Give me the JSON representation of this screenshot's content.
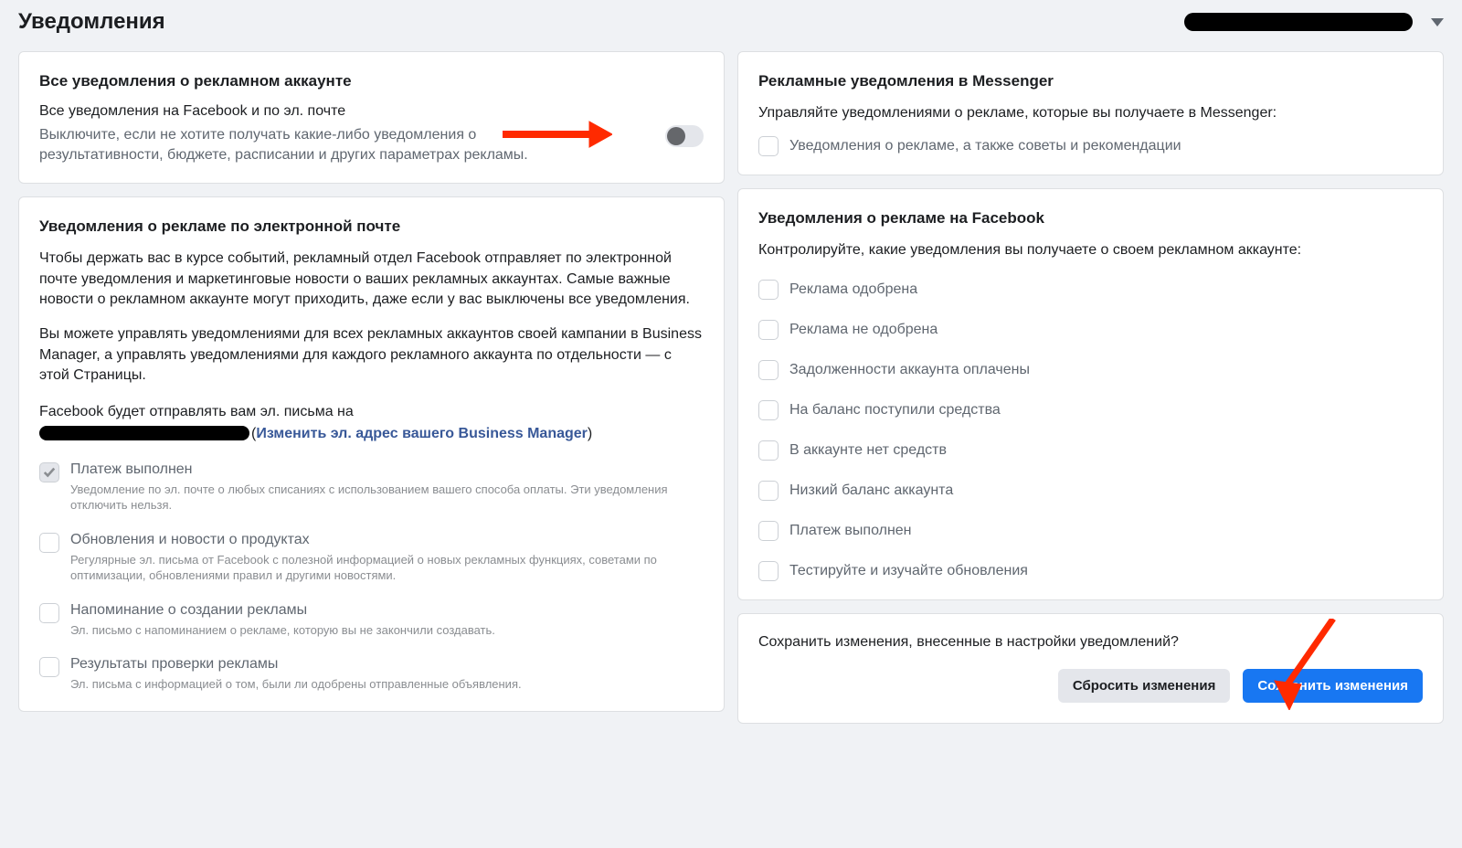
{
  "page": {
    "title": "Уведомления"
  },
  "left": {
    "allAdNotif": {
      "title": "Все уведомления о рекламном аккаунте",
      "subtitle": "Все уведомления на Facebook и по эл. почте",
      "desc": "Выключите, если не хотите получать какие-либо уведомления о результативности, бюджете, расписании и других параметрах рекламы."
    },
    "emailNotif": {
      "title": "Уведомления о рекламе по электронной почте",
      "p1": "Чтобы держать вас в курсе событий, рекламный отдел Facebook отправляет по электронной почте уведомления и маркетинговые новости о ваших рекламных аккаунтах. Самые важные новости о рекламном аккаунте могут приходить, даже если у вас выключены все уведомления.",
      "p2": "Вы можете управлять уведомлениями для всех рекламных аккаунтов своей кампании в Business Manager, а управлять уведомлениями для каждого рекламного аккаунта по отдельности — с этой Страницы.",
      "emailLine1": "Facebook будет отправлять вам эл. письма на",
      "emailChangeOpen": "(",
      "emailChangeLink": "Изменить эл. адрес вашего Business Manager",
      "emailChangeClose": ")",
      "items": [
        {
          "label": "Платеж выполнен",
          "sub": "Уведомление по эл. почте о любых списаниях с использованием вашего способа оплаты. Эти уведомления отключить нельзя.",
          "checkedDisabled": true
        },
        {
          "label": "Обновления и новости о продуктах",
          "sub": "Регулярные эл. письма от Facebook с полезной информацией о новых рекламных функциях, советами по оптимизации, обновлениями правил и другими новостями."
        },
        {
          "label": "Напоминание о создании рекламы",
          "sub": "Эл. письмо с напоминанием о рекламе, которую вы не закончили создавать."
        },
        {
          "label": "Результаты проверки рекламы",
          "sub": "Эл. письма с информацией о том, были ли одобрены отправленные объявления."
        }
      ]
    }
  },
  "right": {
    "messenger": {
      "title": "Рекламные уведомления в Messenger",
      "desc": "Управляйте уведомлениями о рекламе, которые вы получаете в Messenger:",
      "item": "Уведомления о рекламе, а также советы и рекомендации"
    },
    "fbAds": {
      "title": "Уведомления о рекламе на Facebook",
      "desc": "Контролируйте, какие уведомления вы получаете о своем рекламном аккаунте:",
      "items": [
        "Реклама одобрена",
        "Реклама не одобрена",
        "Задолженности аккаунта оплачены",
        "На баланс поступили средства",
        "В аккаунте нет средств",
        "Низкий баланс аккаунта",
        "Платеж выполнен",
        "Тестируйте и изучайте обновления"
      ]
    },
    "save": {
      "text": "Сохранить изменения, внесенные в настройки уведомлений?",
      "reset": "Сбросить изменения",
      "save": "Сохранить изменения"
    }
  }
}
